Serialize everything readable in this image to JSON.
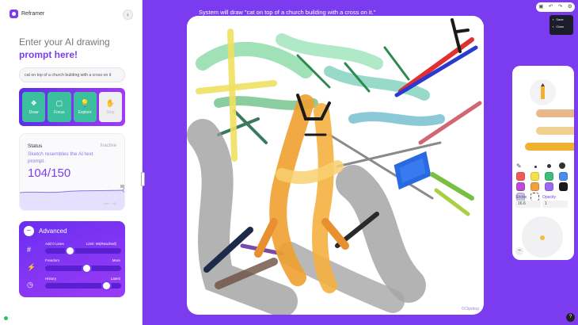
{
  "app": {
    "name": "Reframer"
  },
  "sidebar": {
    "heading_line1": "Enter your AI drawing",
    "heading_line2": "prompt here!",
    "prompt_value": "cat on top of a church building with a cross on it",
    "modes": [
      {
        "label": "Draw",
        "icon": "palette-icon",
        "state": "active"
      },
      {
        "label": "Focus",
        "icon": "chat-icon",
        "state": "active"
      },
      {
        "label": "Explore",
        "icon": "lightbulb-icon",
        "state": "active"
      },
      {
        "label": "Stop",
        "icon": "hand-icon",
        "state": "disabled"
      }
    ],
    "status": {
      "title": "Status",
      "state": "Inactive",
      "description": "Sketch resembles the AI text prompt.",
      "score": "104/150",
      "caption": "Loss: ~108"
    },
    "advanced": {
      "title": "Advanced",
      "add_lines": "Add 0 Lines",
      "limit": "Limit: 96(Reached)",
      "freedom": "Freedom",
      "freedom_max": "More",
      "history": "History",
      "history_max": "Latest",
      "lines_level": 0.3,
      "freedom_level": 0.55,
      "history_level": 0.85
    }
  },
  "canvas": {
    "status_text": "System will draw \"cat on top of a church building with a cross on it.\"",
    "watermark": "©Clipdrop"
  },
  "toolbar": {
    "icons": [
      "save-icon",
      "undo-icon",
      "redo-icon",
      "settings-icon"
    ],
    "save_label": "Save",
    "clear_label": "Clear"
  },
  "tools": {
    "stroke_label": "Stroke",
    "stroke_value": "16.6",
    "opacity_label": "Opacity",
    "opacity_value": "1",
    "colors": [
      "#f05a5a",
      "#f5e04a",
      "#3bbf7a",
      "#4a8cf0",
      "#c04ad8",
      "#f0a040",
      "#9b6af0",
      "#1a1a1a",
      "#c0c8d0",
      "#ffffff"
    ]
  },
  "help": {
    "label": "?"
  }
}
